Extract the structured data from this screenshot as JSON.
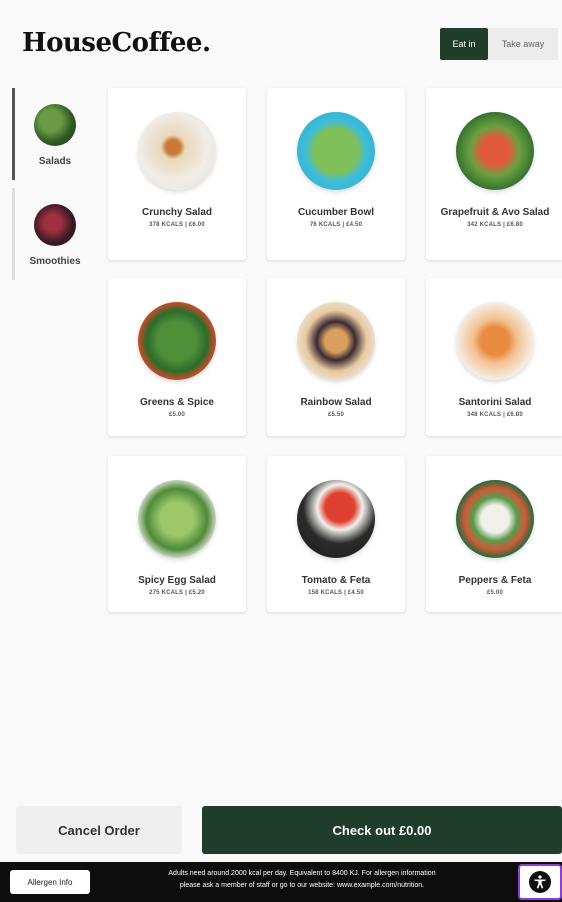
{
  "header": {
    "logo": "HouseCoffee.",
    "toggle": {
      "eat_in": "Eat in",
      "take_away": "Take away",
      "selected": "Eat in"
    }
  },
  "sidebar": {
    "items": [
      {
        "label": "Salads",
        "icon": "salad-thumbnail",
        "active": true
      },
      {
        "label": "Smoothies",
        "icon": "smoothie-thumbnail",
        "active": false
      }
    ]
  },
  "products": [
    {
      "name": "Crunchy Salad",
      "meta": "378 KCALS | £6.00"
    },
    {
      "name": "Cucumber Bowl",
      "meta": "76 KCALS | £4.50"
    },
    {
      "name": "Grapefruit & Avo Salad",
      "meta": "342 KCALS | £6.80"
    },
    {
      "name": "Greens & Spice",
      "meta": "£5.00"
    },
    {
      "name": "Rainbow Salad",
      "meta": "£5.50"
    },
    {
      "name": "Santorini Salad",
      "meta": "348 KCALS | £6.80"
    },
    {
      "name": "Spicy Egg Salad",
      "meta": "275 KCALS | £5.20"
    },
    {
      "name": "Tomato & Feta",
      "meta": "158 KCALS | £4.50"
    },
    {
      "name": "Peppers & Feta",
      "meta": "£5.00"
    }
  ],
  "actions": {
    "cancel_label": "Cancel Order",
    "checkout_label": "Check out £0.00"
  },
  "footer": {
    "allergen_label": "Allergen Info",
    "notice_line1": "Adults need around 2000 kcal per day. Equivalent to 8400 KJ. For allergen information",
    "notice_line2": "please ask a member of staff or go to our website: www.example.com/nutrition.",
    "accessibility_icon": "accessibility-icon"
  },
  "colors": {
    "brand_green": "#1f3d2a",
    "accessibility_outline": "#8b3fd6"
  }
}
